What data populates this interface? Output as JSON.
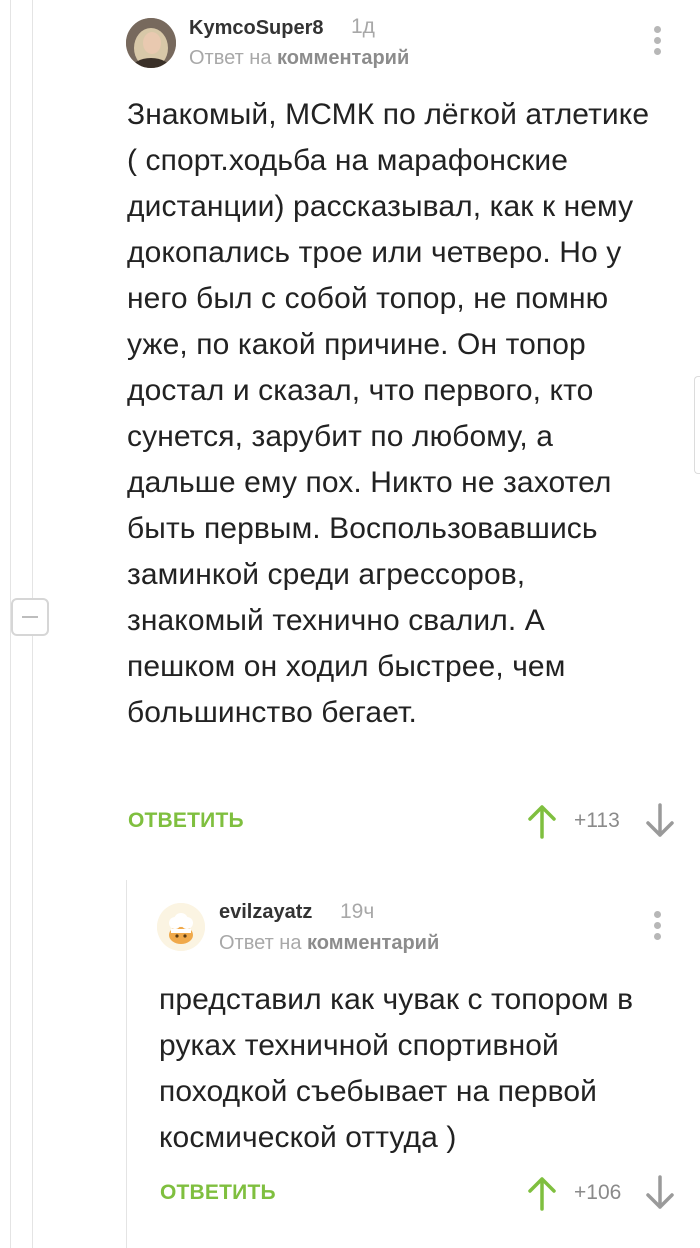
{
  "comments": [
    {
      "username": "KymcoSuper8",
      "time": "1д",
      "reply_prefix": "Ответ на",
      "reply_link": "комментарий",
      "text": "Знакомый, МСМК по лёгкой атлетике ( спорт.ходьба на марафонские дистанции) рассказывал, как к нему докопались трое или четверо. Но у него был с собой топор, не помню уже, по какой причине. Он топор достал и сказал, что первого, кто сунется, зарубит по любому, а дальше ему пох. Никто не захотел быть первым. Воспользовавшись заминкой среди агрессоров, знакомый технично свалил. А пешком он ходил быстрее, чем большинство бегает.",
      "reply_label": "ОТВЕТИТЬ",
      "rating": "+113"
    },
    {
      "username": "evilzayatz",
      "time": "19ч",
      "reply_prefix": "Ответ на",
      "reply_link": "комментарий",
      "text": "представил как чувак с топором в руках техничной спортивной походкой съебывает на первой космической оттуда )",
      "reply_label": "ОТВЕТИТЬ",
      "rating": "+106"
    }
  ],
  "colors": {
    "accent_green": "#7fbf3f",
    "meta_gray": "#a8a8a8",
    "thread_line": "#e4e4e4"
  },
  "icons": [
    "user-avatar",
    "chef-hat-avatar",
    "more-options-icon",
    "upvote-arrow-icon",
    "downvote-arrow-icon",
    "collapse-minus-icon"
  ]
}
